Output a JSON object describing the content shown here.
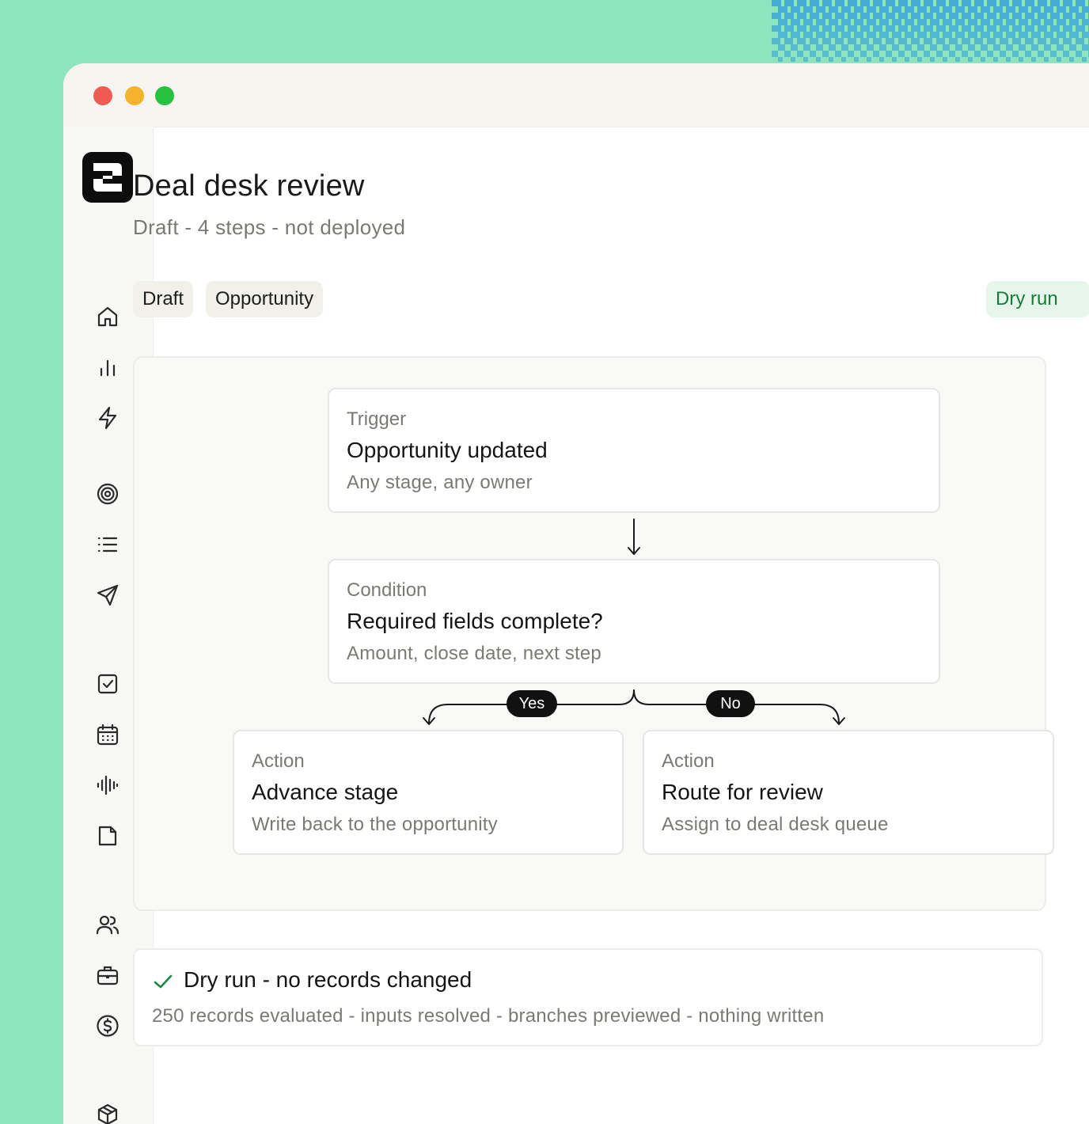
{
  "window": {
    "controls": [
      "close",
      "minimize",
      "maximize"
    ]
  },
  "sidebar": {
    "logo": "app-logo",
    "items": [
      {
        "icon": "home-icon"
      },
      {
        "icon": "bar-chart-icon"
      },
      {
        "icon": "lightning-icon"
      },
      {
        "icon": "target-icon"
      },
      {
        "icon": "list-icon"
      },
      {
        "icon": "send-icon"
      },
      {
        "icon": "checkbox-icon"
      },
      {
        "icon": "calendar-icon"
      },
      {
        "icon": "waveform-icon"
      },
      {
        "icon": "document-icon"
      },
      {
        "icon": "users-icon"
      },
      {
        "icon": "briefcase-icon"
      },
      {
        "icon": "dollar-icon"
      },
      {
        "icon": "package-icon"
      }
    ]
  },
  "header": {
    "title": "Deal desk review",
    "subtitle": "Draft - 4 steps - not deployed"
  },
  "chips": {
    "status": "Draft",
    "object": "Opportunity",
    "dry_run": "Dry run"
  },
  "flow": {
    "trigger": {
      "kind": "Trigger",
      "name": "Opportunity updated",
      "desc": "Any stage, any owner"
    },
    "condition": {
      "kind": "Condition",
      "name": "Required fields complete?",
      "desc": "Amount, close date, next step"
    },
    "yes_label": "Yes",
    "no_label": "No",
    "action_yes": {
      "kind": "Action",
      "name": "Advance stage",
      "desc": "Write back to the opportunity"
    },
    "action_no": {
      "kind": "Action",
      "name": "Route for review",
      "desc": "Assign to deal desk queue"
    }
  },
  "result": {
    "title": "Dry run - no records changed",
    "desc": "250 records evaluated - inputs resolved - branches previewed - nothing written"
  },
  "colors": {
    "background": "#8ee4bd",
    "accent_green": "#1b8a3e",
    "pixel_blue": "#3fa9d8"
  }
}
